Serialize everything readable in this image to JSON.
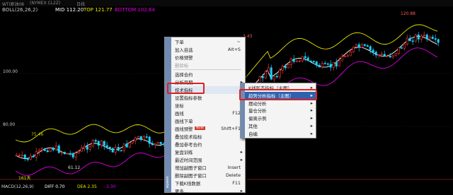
{
  "header": {
    "symbol": "WTI原油08",
    "code": "(NYMEX CL2Z)",
    "period": "日线"
  },
  "indicator_legend": {
    "name": "BOLL(26,26,2)",
    "mid": "MID 112.20",
    "top": "TOP 121.77",
    "bottom": "BOTTOM 102.64",
    "colors": {
      "name": "#c8c8c8",
      "mid": "#ffffff",
      "top": "#e8e800",
      "bottom": "#e000e0"
    }
  },
  "price_axis": {
    "labels": [
      "100.00",
      "80.00"
    ]
  },
  "price_annotations": {
    "high_right": "120.88",
    "menu_edge": "3.43",
    "low": "61.12",
    "left_value": "75.46",
    "count": "161天"
  },
  "macd": {
    "label": "MACD(12,26,9)",
    "diff": "DIFF 0.70",
    "dea": "DEA 2.35",
    "macd_value": "-3.30"
  },
  "context_menu": {
    "brand": "wpwek",
    "items": [
      {
        "label": "下单",
        "shortcut": "~"
      },
      {
        "label": "加入自选",
        "shortcut": "Alt+S"
      },
      {
        "label": "价格预警",
        "shortcut": ""
      },
      {
        "label": "删除标",
        "shortcut": "",
        "disabled": true
      },
      {
        "label": "选择合约",
        "shortcut": ""
      },
      {
        "label": "分析周期",
        "shortcut": "",
        "submenu": true
      },
      {
        "label": "技术指标",
        "shortcut": "",
        "submenu": true,
        "highlighted": true
      },
      {
        "label": "设置指标参数",
        "shortcut": ""
      },
      {
        "label": "坐标",
        "shortcut": "",
        "submenu": true
      },
      {
        "label": "画线",
        "shortcut": "F12"
      },
      {
        "label": "画线下单",
        "shortcut": ""
      },
      {
        "label": "画线预警",
        "shortcut": "Shift+F1",
        "badge": "NEW"
      },
      {
        "label": "叠加技术指标",
        "shortcut": ""
      },
      {
        "label": "叠加参考合约",
        "shortcut": ""
      },
      {
        "label": "复盘训练",
        "shortcut": "",
        "submenu": true
      },
      {
        "label": "最近时间范围",
        "shortcut": "",
        "submenu": true
      },
      {
        "label": "增加副图子窗口",
        "shortcut": "Insert"
      },
      {
        "label": "删除副图子窗口",
        "shortcut": "Delete"
      },
      {
        "label": "下载K线数据",
        "shortcut": "F11"
      },
      {
        "label": "更多...",
        "shortcut": "",
        "submenu": true
      }
    ]
  },
  "submenu": {
    "items": [
      {
        "label": "K线形态指标（主图）",
        "submenu": true
      },
      {
        "label": "趋势分析指标（主图）",
        "submenu": true,
        "selected": true
      },
      {
        "label": "摆动分析",
        "submenu": true
      },
      {
        "label": "量仓分析",
        "submenu": true
      },
      {
        "label": "偏离示例",
        "submenu": true
      },
      {
        "label": "其他",
        "submenu": true
      },
      {
        "label": "自编",
        "submenu": true
      }
    ]
  }
}
